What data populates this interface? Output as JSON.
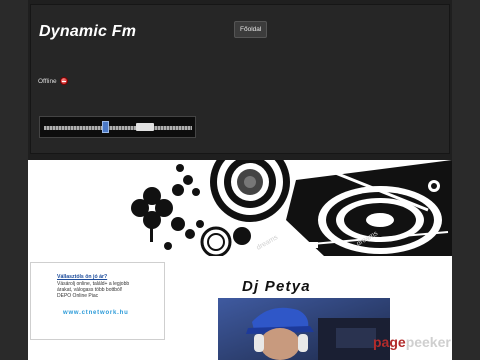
{
  "header": {
    "site_title": "Dynamic Fm",
    "nav_button": "Főoldal",
    "status_text": "Offline"
  },
  "ad": {
    "title": "Vállasztóls ön jó ár?",
    "lines": [
      "Vásárolj online, találd+ a legjobb",
      "árakat, válogass több bottból!",
      "DEPO Online Piac"
    ],
    "link": "www.ctnetwork.hu"
  },
  "dj": {
    "title": "Dj Petya"
  },
  "watermark": {
    "part1": "page",
    "part2": "peeker"
  },
  "colors": {
    "page_bg": "#2a2a2a",
    "header_bg": "#262626",
    "link_blue": "#2a9ad8",
    "offline_red": "#c01414",
    "watermark_red": "#b22b2b"
  },
  "icons": [
    "offline-status-icon",
    "volume-icon"
  ]
}
